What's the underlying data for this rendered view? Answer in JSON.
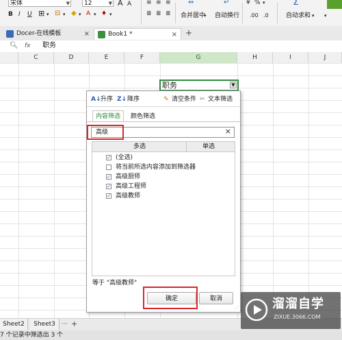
{
  "ribbon": {
    "font_name": "宋体",
    "font_size": "12",
    "font_grow": "A",
    "font_shrink": "A",
    "bold": "B",
    "italic": "I",
    "underline": "U",
    "merge_center": "合并居中",
    "wrap_text": "自动换行",
    "autosum": "自动求和",
    "percent": "%",
    "decimal_inc": ".00",
    "decimal_dec": ".0"
  },
  "tabs": [
    {
      "label": "Docer-在线模板",
      "close": "×"
    },
    {
      "label": "Book1 *",
      "close": "×"
    }
  ],
  "new_tab": "+",
  "formula_bar": {
    "fx": "fx",
    "value": "职务"
  },
  "columns": [
    "C",
    "D",
    "E",
    "F",
    "G",
    "H",
    "I",
    "J"
  ],
  "active_cell": {
    "value": "职务"
  },
  "filter": {
    "sort_asc": "升序",
    "sort_desc": "降序",
    "clear": "清空条件",
    "text_filter": "文本筛选",
    "tab_content": "内容筛选",
    "tab_color": "颜色筛选",
    "search_value": "高级",
    "search_clear": "×",
    "col_multi": "多选",
    "col_single": "单选",
    "items": [
      {
        "label": "(全选)",
        "checked": true
      },
      {
        "label": "将当前所选内容添加到筛选器",
        "checked": false
      },
      {
        "label": "高级厨师",
        "checked": true
      },
      {
        "label": "高级工程师",
        "checked": true
      },
      {
        "label": "高级教师",
        "checked": true
      }
    ],
    "footer": "等于 \"高级教师\"",
    "ok": "确定",
    "cancel": "取消"
  },
  "sheets": [
    "Sheet2",
    "Sheet3"
  ],
  "sheet_more": "···",
  "sheet_add": "+",
  "status_text": "7 个记录中筛选出 3 个",
  "watermark": {
    "title": "溜溜自学",
    "url": "ZIXUE.3066.COM"
  },
  "colors": {
    "accent_green": "#2f8a3c",
    "highlight_red": "#d9252b",
    "dialog_blue": "#2b58b5"
  }
}
